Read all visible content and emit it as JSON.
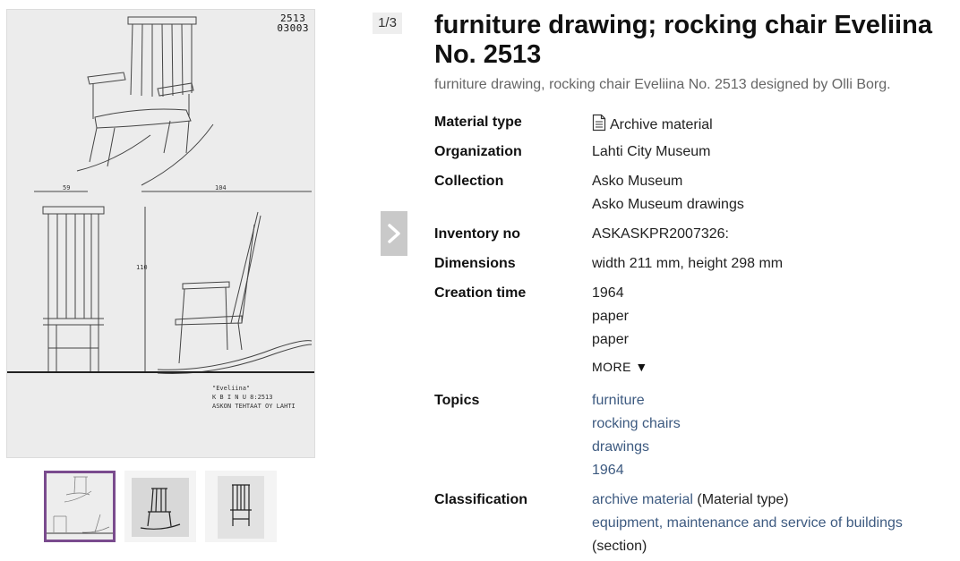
{
  "viewer": {
    "counter": "1/3",
    "drawing_code_top": "2513",
    "drawing_code_bottom": "03003",
    "dimension_labels": [
      "59",
      "104",
      "110"
    ],
    "caption_lines": [
      "\"Eveliina\"",
      "K B I N U  8:2513",
      "ASKON TEHTAAT OY LAHTI"
    ]
  },
  "record": {
    "title": "furniture drawing; rocking chair Eveliina No. 2513",
    "subtitle": "furniture drawing, rocking chair Eveliina No. 2513 designed by Olli Borg.",
    "material_type": {
      "label": "Material type",
      "value": "Archive material",
      "icon": "document-icon"
    },
    "organization": {
      "label": "Organization",
      "value": "Lahti City Museum"
    },
    "collection": {
      "label": "Collection",
      "values": [
        "Asko Museum",
        "Asko Museum drawings"
      ]
    },
    "inventory": {
      "label": "Inventory no",
      "value": "ASKASKPR2007326:"
    },
    "dimensions": {
      "label": "Dimensions",
      "value": "width 211 mm, height 298 mm"
    },
    "creation": {
      "label": "Creation time",
      "values": [
        "1964",
        "paper",
        "paper"
      ],
      "more_label": "MORE ▼"
    },
    "topics": {
      "label": "Topics",
      "values": [
        "furniture",
        "rocking chairs",
        "drawings",
        "1964"
      ]
    },
    "classification": {
      "label": "Classification",
      "items": [
        {
          "link": "archive material",
          "suffix": " (Material type)"
        },
        {
          "link": "equipment, maintenance and service of buildings",
          "suffix": ""
        }
      ],
      "trailing": "(section)"
    }
  },
  "colors": {
    "link": "#3d5a80",
    "thumb_active_border": "#7a4b8e",
    "arrow_bg": "#c9c9c9"
  }
}
